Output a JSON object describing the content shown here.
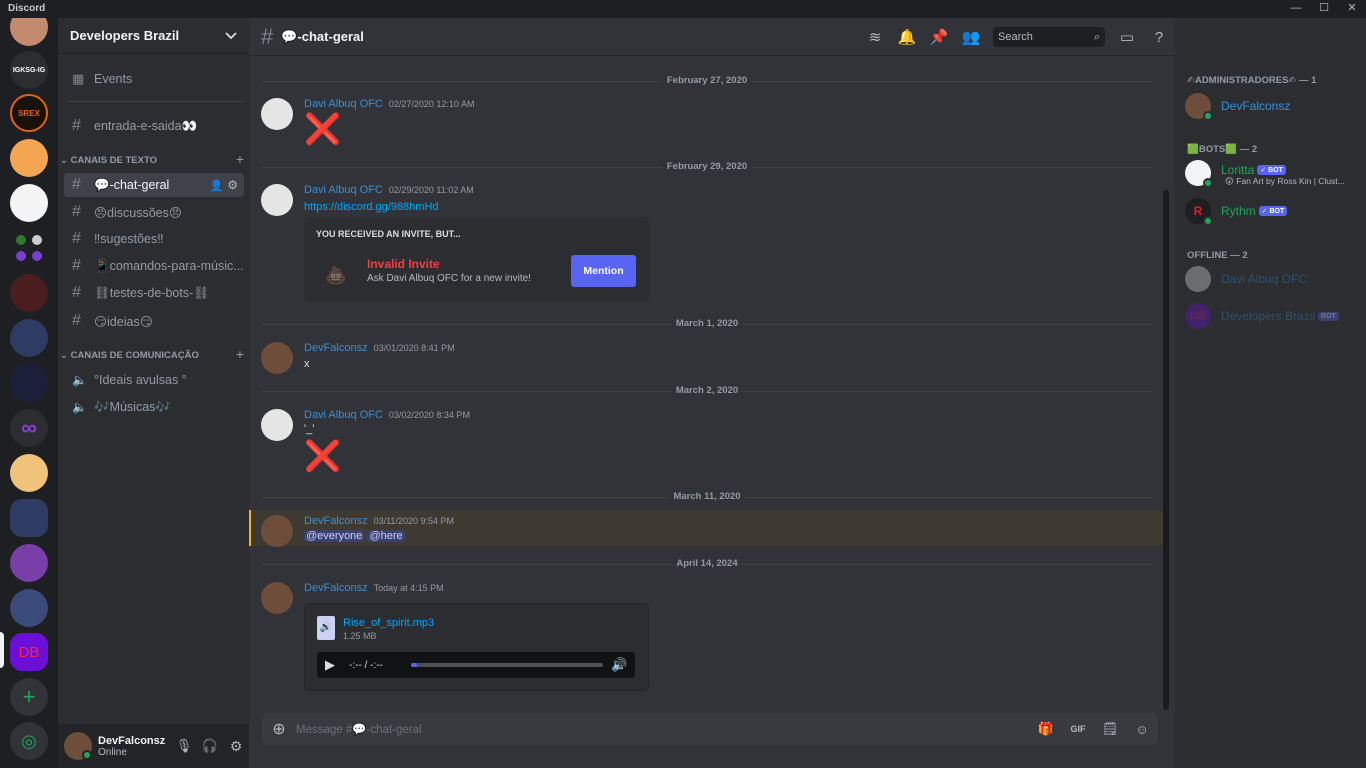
{
  "app": {
    "name": "Discord"
  },
  "window_controls": {
    "minimize": "—",
    "maximize": "☐",
    "close": "✕"
  },
  "rail": {
    "servers": [
      {
        "label": ""
      },
      {
        "label": "IGKSG-IG"
      },
      {
        "label": "SREX"
      },
      {
        "label": ""
      },
      {
        "label": ""
      },
      {
        "label": ""
      },
      {
        "label": ""
      },
      {
        "label": ""
      },
      {
        "label": ""
      },
      {
        "label": "∞"
      },
      {
        "label": ""
      },
      {
        "label": ""
      },
      {
        "label": ""
      },
      {
        "label": ""
      },
      {
        "label": "DB"
      }
    ],
    "add_server": "+",
    "discover": "◎",
    "colors": {
      "selected_server": "#6b0fd6",
      "add": "#23a55a"
    }
  },
  "guild": {
    "name": "Developers Brazil",
    "events_label": "Events",
    "top_channel": "entrada-e-saida👀",
    "categories": [
      {
        "name": "CANAIS DE TEXTO"
      },
      {
        "name": "CANAIS DE COMUNICAÇÃO"
      }
    ],
    "text_channels": [
      "💬-chat-geral",
      "😠discussões😠",
      "‼sugestões‼",
      "📱comandos-para-músic...",
      "⛓testes-de-bots-⛓",
      "😏ideias😏"
    ],
    "voice_channels": [
      "°Ideais avulsas °",
      "🎶Músicas🎶"
    ]
  },
  "user_panel": {
    "name": "DevFalconsz",
    "status": "Online"
  },
  "channel": {
    "title": "💬-chat-geral",
    "search_placeholder": "Search",
    "composer_placeholder": "Message #💬-chat-geral"
  },
  "messages": [
    {
      "date": "February 27, 2020",
      "author": "Davi Albuq OFC",
      "timestamp": "02/27/2020 12:10 AM",
      "content": "❌"
    },
    {
      "date": "February 29, 2020",
      "author": "Davi Albuq OFC",
      "timestamp": "02/29/2020 11:02 AM",
      "content": "https://discord.gg/988hmHd",
      "invite": {
        "heading": "YOU RECEIVED AN INVITE, BUT...",
        "title": "Invalid Invite",
        "subtitle": "Ask Davi Albuq OFC for a new invite!",
        "button": "Mention"
      }
    },
    {
      "date": "March 1, 2020",
      "author": "DevFalconsz",
      "timestamp": "03/01/2020 8:41 PM",
      "content": "x"
    },
    {
      "date": "March 2, 2020",
      "author": "Davi Albuq OFC",
      "timestamp": "03/02/2020 8:34 PM",
      "content": "'_'",
      "content2": "❌"
    },
    {
      "date": "March 11, 2020",
      "author": "DevFalconsz",
      "timestamp": "03/11/2020 9:54 PM",
      "mention1": "@everyone",
      "mention2": "@here"
    },
    {
      "date": "April 14, 2024",
      "author": "DevFalconsz",
      "timestamp": "Today at 4:15 PM",
      "attachment": {
        "filename": "Rise_of_spirit.mp3",
        "size": "1.25 MB",
        "time": "-:-- / -:--",
        "progress": 0.03
      }
    }
  ],
  "members": {
    "categories": [
      {
        "label": "✍ADMINISTRADORES✍ — 1"
      },
      {
        "label": "🟩BOTS🟩 — 2"
      },
      {
        "label": "OFFLINE — 2"
      }
    ],
    "list": [
      {
        "name": "DevFalconsz",
        "color": "#3b8fd6"
      },
      {
        "name": "Loritta",
        "color": "#23a55a",
        "badge": "✓ BOT",
        "activity": "😲 Fan Art by Ross Kin | Clust..."
      },
      {
        "name": "Rythm",
        "color": "#23a55a",
        "badge": "✓ BOT"
      },
      {
        "name": "Davi Albuq OFC",
        "color": "#3b8fd6"
      },
      {
        "name": "Developers Brazil",
        "color": "#3b8fd6",
        "badge": "BOT"
      }
    ]
  },
  "colors": {
    "accent": "#5865f2",
    "mention_highlight": "#f0b232",
    "error": "#f23f43",
    "online": "#23a55a"
  }
}
